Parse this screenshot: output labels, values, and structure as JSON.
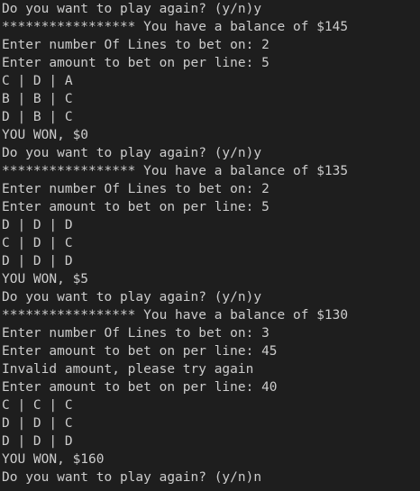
{
  "terminal": {
    "lines": [
      "Do you want to play again? (y/n)y",
      "***************** You have a balance of $145",
      "Enter number Of Lines to bet on: 2",
      "Enter amount to bet on per line: 5",
      "C | D | A",
      "B | B | C",
      "D | B | C",
      "YOU WON, $0",
      "Do you want to play again? (y/n)y",
      "***************** You have a balance of $135",
      "Enter number Of Lines to bet on: 2",
      "Enter amount to bet on per line: 5",
      "D | D | D",
      "C | D | C",
      "D | D | D",
      "YOU WON, $5",
      "Do you want to play again? (y/n)y",
      "***************** You have a balance of $130",
      "Enter number Of Lines to bet on: 3",
      "Enter amount to bet on per line: 45",
      "Invalid amount, please try again",
      "Enter amount to bet on per line: 40",
      "C | C | C",
      "D | D | C",
      "D | D | D",
      "YOU WON, $160",
      "Do you want to play again? (y/n)n"
    ]
  },
  "colors": {
    "background": "#1e1e1e",
    "text": "#cccccc"
  }
}
